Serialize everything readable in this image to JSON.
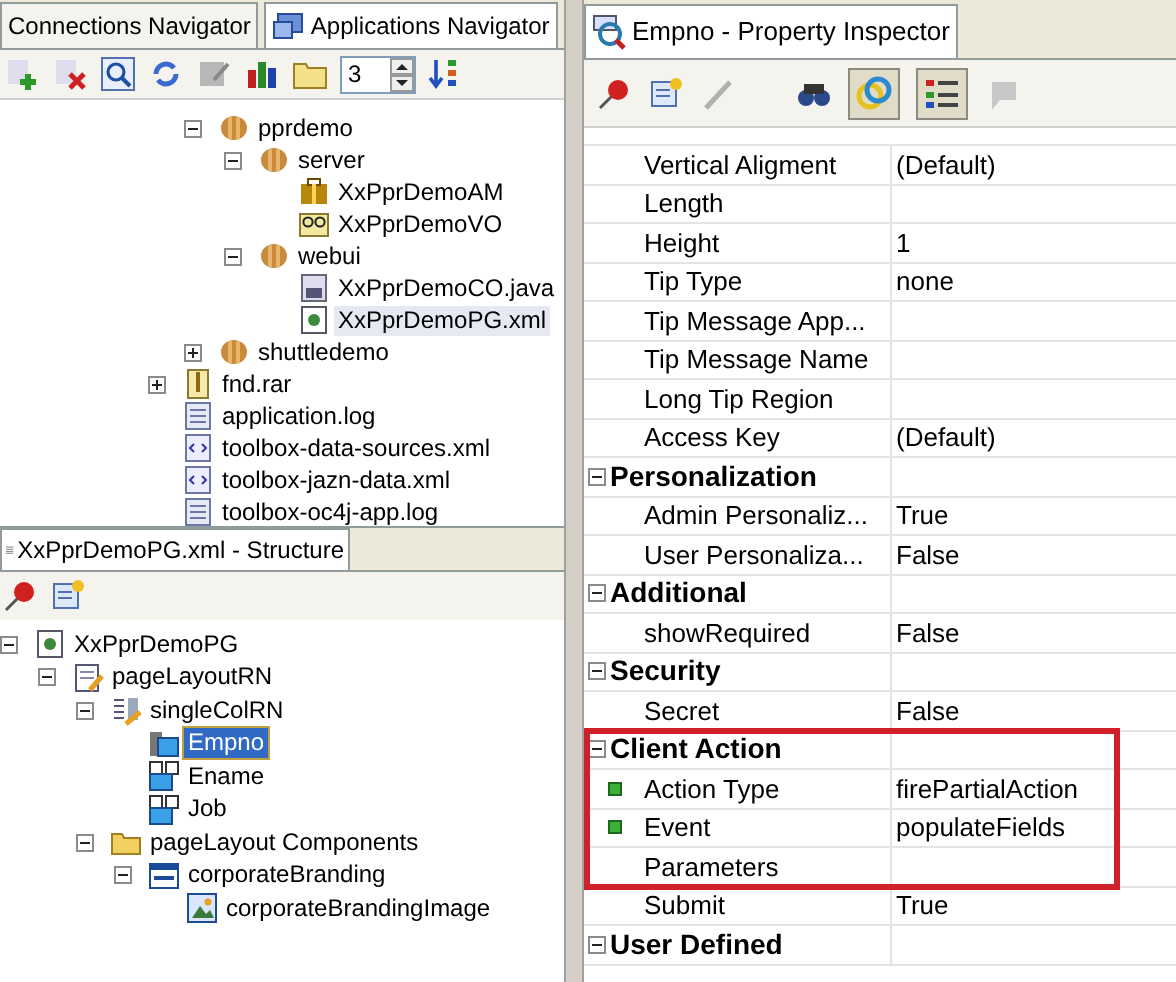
{
  "navigator": {
    "tabs": [
      {
        "label": "Connections Navigator",
        "selected": false
      },
      {
        "label": "Applications Navigator",
        "selected": true
      }
    ],
    "toolbar": {
      "spinner_value": "3"
    },
    "packages": [
      {
        "label": "pprdemo",
        "kind": "package",
        "expanded": true,
        "selected": false,
        "children": [
          {
            "label": "server",
            "kind": "package",
            "expanded": true,
            "selected": false,
            "children": [
              {
                "label": "XxPprDemoAM",
                "kind": "am",
                "selected": false
              },
              {
                "label": "XxPprDemoVO",
                "kind": "vo",
                "selected": false
              }
            ]
          },
          {
            "label": "webui",
            "kind": "package",
            "expanded": true,
            "selected": false,
            "children": [
              {
                "label": "XxPprDemoCO.java",
                "kind": "java",
                "selected": false
              },
              {
                "label": "XxPprDemoPG.xml",
                "kind": "page",
                "selected": true
              }
            ]
          }
        ]
      },
      {
        "label": "shuttledemo",
        "kind": "package",
        "expanded": false,
        "selected": false
      }
    ],
    "files": [
      {
        "label": "fnd.rar",
        "kind": "archive",
        "expanded": false,
        "selected": false
      },
      {
        "label": "application.log",
        "kind": "log",
        "selected": false
      },
      {
        "label": "toolbox-data-sources.xml",
        "kind": "xml",
        "selected": false
      },
      {
        "label": "toolbox-jazn-data.xml",
        "kind": "xml",
        "selected": false
      },
      {
        "label": "toolbox-oc4j-app.log",
        "kind": "log",
        "selected": false
      }
    ]
  },
  "structure": {
    "title": "XxPprDemoPG.xml - Structure",
    "tree": [
      {
        "label": "XxPprDemoPG",
        "kind": "page",
        "expanded": true,
        "selected": false,
        "children": [
          {
            "label": "pageLayoutRN",
            "kind": "layout",
            "expanded": true,
            "selected": false,
            "children": [
              {
                "label": "singleColRN",
                "kind": "region",
                "expanded": true,
                "selected": false,
                "children": [
                  {
                    "label": "Empno",
                    "kind": "field",
                    "selected": true
                  },
                  {
                    "label": "Ename",
                    "kind": "item",
                    "selected": false
                  },
                  {
                    "label": "Job",
                    "kind": "item",
                    "selected": false
                  }
                ]
              },
              {
                "label": "pageLayout Components",
                "kind": "folder",
                "expanded": true,
                "selected": false,
                "children": [
                  {
                    "label": "corporateBranding",
                    "kind": "branding",
                    "expanded": true,
                    "selected": false,
                    "children": [
                      {
                        "label": "corporateBrandingImage",
                        "kind": "image",
                        "selected": false
                      }
                    ]
                  }
                ]
              }
            ]
          }
        ]
      }
    ]
  },
  "inspector": {
    "title": "Empno - Property Inspector",
    "rows": [
      {
        "kind": "property",
        "name": "Vertical Aligment",
        "value": "(Default)",
        "modified": false
      },
      {
        "kind": "property",
        "name": "Length",
        "modified": false
      },
      {
        "kind": "property",
        "name": "Height",
        "value": "1",
        "modified": false
      },
      {
        "kind": "property",
        "name": "Tip Type",
        "value": "none",
        "modified": false
      },
      {
        "kind": "property",
        "name": "Tip Message App...",
        "modified": false
      },
      {
        "kind": "property",
        "name": "Tip Message Name",
        "modified": false
      },
      {
        "kind": "property",
        "name": "Long Tip Region",
        "modified": false
      },
      {
        "kind": "property",
        "name": "Access Key",
        "value": "(Default)",
        "modified": false
      },
      {
        "kind": "category",
        "name": "Personalization",
        "expanded": true
      },
      {
        "kind": "property",
        "name": "Admin Personaliz...",
        "value": "True",
        "modified": false
      },
      {
        "kind": "property",
        "name": "User Personaliza...",
        "value": "False",
        "modified": false
      },
      {
        "kind": "category",
        "name": "Additional",
        "expanded": true
      },
      {
        "kind": "property",
        "name": "showRequired",
        "value": "False",
        "modified": false
      },
      {
        "kind": "category",
        "name": "Security",
        "expanded": true
      },
      {
        "kind": "property",
        "name": "Secret",
        "value": "False",
        "modified": false
      },
      {
        "kind": "category",
        "name": "Client Action",
        "expanded": true,
        "highlighted": true
      },
      {
        "kind": "property",
        "name": "Action Type",
        "value": "firePartialAction",
        "modified": true,
        "highlighted": true
      },
      {
        "kind": "property",
        "name": "Event",
        "value": "populateFields",
        "modified": true,
        "highlighted": true
      },
      {
        "kind": "property",
        "name": "Parameters",
        "modified": false,
        "highlighted": true
      },
      {
        "kind": "property",
        "name": "Submit",
        "value": "True",
        "modified": false
      },
      {
        "kind": "category",
        "name": "User Defined",
        "expanded": true
      }
    ]
  }
}
